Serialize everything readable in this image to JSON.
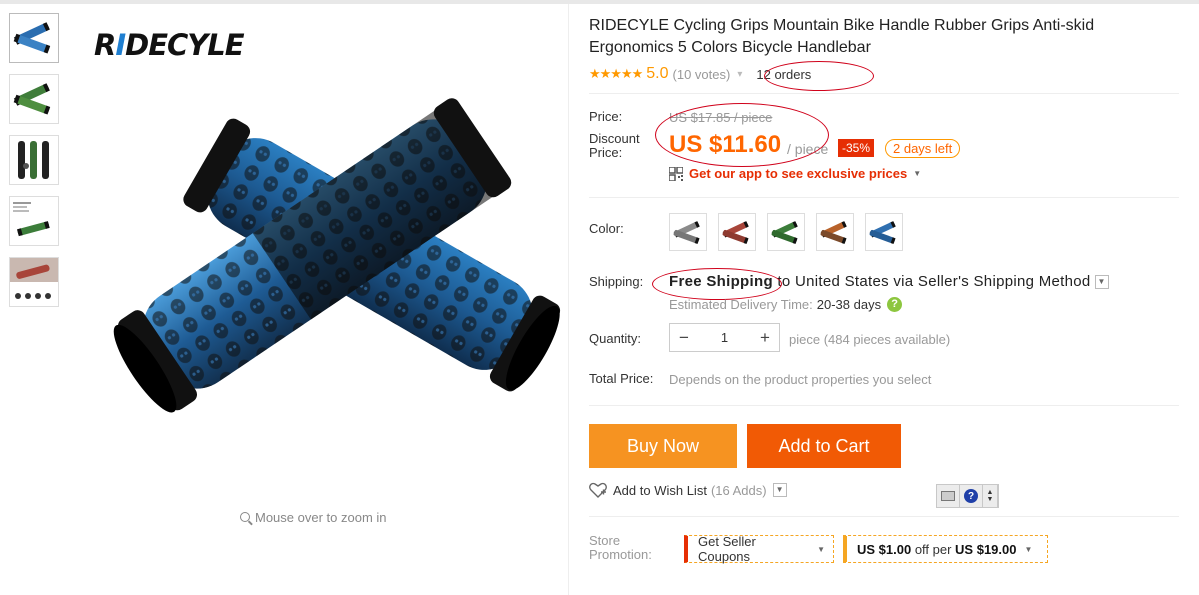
{
  "gallery": {
    "brand": {
      "prefix": "R",
      "i": "I",
      "rest": "DECYLE"
    },
    "thumbnails": [
      "thumb-blue-grips",
      "thumb-green-grips",
      "thumb-black-grips",
      "thumb-promo-grips",
      "thumb-red-grips"
    ],
    "zoom_hint": "Mouse over to zoom in"
  },
  "product": {
    "title": "RIDECYLE Cycling Grips Mountain Bike Handle Rubber Grips Anti-skid Ergonomics 5 Colors Bicycle Handlebar",
    "stars": "★★★★★",
    "rating": "5.0",
    "votes": "(10 votes)",
    "orders": "12 orders"
  },
  "price": {
    "label": "Price:",
    "original": "US $17.85 / piece",
    "discount_label_1": "Discount",
    "discount_label_2": "Price:",
    "current": "US $11.60",
    "per_piece": "/ piece",
    "discount_pct": "-35%",
    "days_left": "2 days left",
    "app_promo": "Get our app to see exclusive prices"
  },
  "color": {
    "label": "Color:",
    "swatches": [
      "gray",
      "red",
      "green",
      "orange",
      "blue"
    ],
    "swatch_colors": [
      "#8a8a8a",
      "#a8453a",
      "#3c7d3a",
      "#b8622a",
      "#2f6fb0"
    ]
  },
  "shipping": {
    "label": "Shipping:",
    "free": "Free Shipping",
    "rest": "to United States via Seller's Shipping Method",
    "delivery_label": "Estimated Delivery Time:",
    "delivery_days": "20-38 days"
  },
  "quantity": {
    "label": "Quantity:",
    "minus": "−",
    "value": "1",
    "plus": "+",
    "note": "piece (484 pieces available)"
  },
  "total": {
    "label": "Total Price:",
    "note": "Depends on the product properties you select"
  },
  "actions": {
    "buy_now": "Buy Now",
    "add_to_cart": "Add to Cart",
    "wishlist": "Add to Wish List",
    "wishlist_count": "(16 Adds)"
  },
  "store": {
    "label_1": "Store",
    "label_2": "Promotion:",
    "coupon_1": "Get Seller Coupons",
    "coupon_2_a": "US $1.00",
    "coupon_2_b": " off per ",
    "coupon_2_c": "US $19.00"
  },
  "colors": {
    "accent_orange": "#f60",
    "buy_now": "#f69321",
    "add_to_cart": "#f15a05",
    "discount_red": "#e62e04",
    "annotation": "#d0021b"
  }
}
